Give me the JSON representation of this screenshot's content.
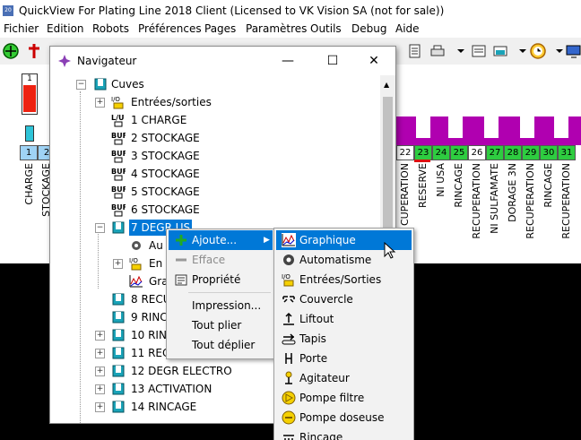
{
  "window": {
    "title": "QuickView For Plating Line 2018 Client  (Licensed to VK Vision SA (not for sale))",
    "app_icon": "20"
  },
  "menubar": [
    "Fichier",
    "Edition",
    "Robots",
    "Préférences",
    "Pages",
    "Paramètres",
    "Outils",
    "Debug",
    "Aide"
  ],
  "background": {
    "tank_numbers": [
      "1",
      "2",
      "22",
      "23",
      "24",
      "25",
      "26",
      "27",
      "28",
      "29",
      "30",
      "31"
    ],
    "indicator": "1",
    "labels_left": [
      "CHARGE",
      "STOCKAGE"
    ],
    "labels_right": [
      "CUPERATION",
      "RESERVE",
      "NI USA",
      "RINCAGE",
      "RECUPERATION",
      "NI SULFAMATE",
      "DORAGE 3N",
      "RECUPERATION",
      "RINCAGE",
      "RECUPERATION"
    ]
  },
  "navigator": {
    "title": "Navigateur",
    "tree": [
      {
        "label": "Cuves",
        "icon": "tank-icon"
      },
      {
        "label": "Entrées/sorties",
        "icon": "io-icon"
      },
      {
        "label": "1 CHARGE",
        "icon": "load-unload-icon"
      },
      {
        "label": "2 STOCKAGE",
        "icon": "buffer-icon"
      },
      {
        "label": "3 STOCKAGE",
        "icon": "buffer-icon"
      },
      {
        "label": "4 STOCKAGE",
        "icon": "buffer-icon"
      },
      {
        "label": "5 STOCKAGE",
        "icon": "buffer-icon"
      },
      {
        "label": "6 STOCKAGE",
        "icon": "buffer-icon"
      },
      {
        "label": "7 DEGR US",
        "icon": "tank-icon"
      },
      {
        "label": "Au",
        "icon": "gear-icon"
      },
      {
        "label": "En",
        "icon": "io-icon"
      },
      {
        "label": "Gra",
        "icon": "graph-icon"
      },
      {
        "label": "8 RECU",
        "icon": "tank-icon"
      },
      {
        "label": "9 RINC",
        "icon": "tank-icon"
      },
      {
        "label": "10 RINC",
        "icon": "tank-icon"
      },
      {
        "label": "11 REC",
        "icon": "tank-icon"
      },
      {
        "label": "12 DEGR ELECTRO",
        "icon": "tank-icon"
      },
      {
        "label": "13 ACTIVATION",
        "icon": "tank-icon"
      },
      {
        "label": "14 RINCAGE",
        "icon": "tank-icon"
      }
    ]
  },
  "context_menu": {
    "items": [
      {
        "label": "Ajoute...",
        "icon": "plus-icon",
        "submenu": true
      },
      {
        "label": "Efface",
        "icon": "minus-icon",
        "disabled": true
      },
      {
        "label": "Propriété",
        "icon": "properties-icon"
      },
      {
        "label": "Impression..."
      },
      {
        "label": "Tout plier"
      },
      {
        "label": "Tout déplier"
      }
    ]
  },
  "submenu": {
    "items": [
      {
        "label": "Graphique",
        "icon": "graph-icon",
        "selected": true
      },
      {
        "label": "Automatisme",
        "icon": "gear-icon"
      },
      {
        "label": "Entrées/Sorties",
        "icon": "io-icon"
      },
      {
        "label": "Couvercle",
        "icon": "cover-icon"
      },
      {
        "label": "Liftout",
        "icon": "liftout-icon"
      },
      {
        "label": "Tapis",
        "icon": "conveyor-icon"
      },
      {
        "label": "Porte",
        "icon": "door-icon"
      },
      {
        "label": "Agitateur",
        "icon": "agitator-icon"
      },
      {
        "label": "Pompe filtre",
        "icon": "filter-pump-icon"
      },
      {
        "label": "Pompe doseuse",
        "icon": "dosing-pump-icon"
      },
      {
        "label": "Rincage",
        "icon": "rinse-icon"
      }
    ]
  },
  "colors": {
    "selection": "#0078d7",
    "tank_icon": "#1aa3b8",
    "magenta": "#b000b0",
    "green": "#2ecc40"
  }
}
